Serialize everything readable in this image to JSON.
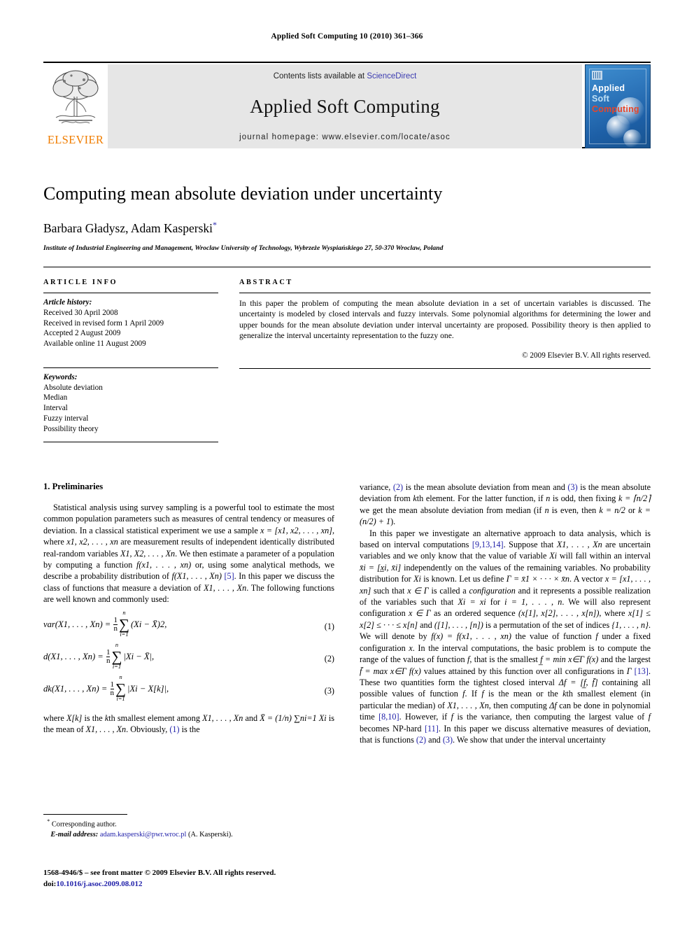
{
  "running_head": "Applied Soft Computing 10 (2010) 361–366",
  "masthead": {
    "contents_prefix": "Contents lists available at ",
    "sciencedirect": "ScienceDirect",
    "journal_title": "Applied Soft Computing",
    "homepage": "journal homepage: www.elsevier.com/locate/asoc",
    "publisher_wordmark": "ELSEVIER",
    "cover": {
      "line1": "Applied",
      "line2": "Soft",
      "line3": "Computing"
    },
    "colors": {
      "link": "#3a3ab0",
      "elsevier_orange": "#F07D00",
      "cover_blue": "#2f78bd",
      "cover_red": "#e8462a"
    }
  },
  "title_block": {
    "title": "Computing mean absolute deviation under uncertainty",
    "authors": "Barbara Gładysz, Adam Kasperski",
    "corresponding_marker": "*",
    "affiliation": "Institute of Industrial Engineering and Management, Wroclaw University of Technology, Wybrzeże Wyspiańskiego 27, 50-370 Wroclaw, Poland"
  },
  "article_info": {
    "heading": "ARTICLE INFO",
    "history_label": "Article history:",
    "history": [
      "Received 30 April 2008",
      "Received in revised form 1 April 2009",
      "Accepted 2 August 2009",
      "Available online 11 August 2009"
    ],
    "keywords_label": "Keywords:",
    "keywords": [
      "Absolute deviation",
      "Median",
      "Interval",
      "Fuzzy interval",
      "Possibility theory"
    ]
  },
  "abstract": {
    "heading": "ABSTRACT",
    "text": "In this paper the problem of computing the mean absolute deviation in a set of uncertain variables is discussed. The uncertainty is modeled by closed intervals and fuzzy intervals. Some polynomial algorithms for determining the lower and upper bounds for the mean absolute deviation under interval uncertainty are proposed. Possibility theory is then applied to generalize the interval uncertainty representation to the fuzzy one.",
    "copyright": "© 2009 Elsevier B.V. All rights reserved."
  },
  "section": {
    "number_title": "1. Preliminaries"
  },
  "left_column": {
    "para1_a": "Statistical analysis using survey sampling is a powerful tool to estimate the most common population parameters such as measures of central tendency or measures of deviation. In a classical statistical experiment we use a sample ",
    "para1_sample": "x = [x1, x2, . . . , xn]",
    "para1_b": ", where ",
    "para1_vars": "x1, x2, . . . , xn",
    "para1_c": " are measurement results of independent identically distributed real-random variables ",
    "para1_Xvars": "X1, X2, . . . , Xn",
    "para1_d": ". We then estimate a parameter of a population by computing a function ",
    "para1_fx": "f(x1, . . . , xn)",
    "para1_e": " or, using some analytical methods, we describe a probability distribution of ",
    "para1_fX": "f(X1, . . . , Xn)",
    "para1_ref": "[5]",
    "para1_f": ". In this paper we discuss the class of functions that measure a deviation of ",
    "para1_Xvars2": "X1, . . . , Xn",
    "para1_g": ". The following functions are well known and commonly used:",
    "eq1": {
      "lhs": "var(X1, . . . , Xn) =",
      "frac_num": "1",
      "frac_den": "n",
      "sum_top": "n",
      "sum_bot": "i=1",
      "rhs": "(Xi − X̄)2,",
      "number": "(1)"
    },
    "eq2": {
      "lhs": "d(X1, . . . , Xn) =",
      "frac_num": "1",
      "frac_den": "n",
      "sum_top": "n",
      "sum_bot": "i=1",
      "rhs": "|Xi − X̄|,",
      "number": "(2)"
    },
    "eq3": {
      "lhs": "dk(X1, . . . , Xn) =",
      "frac_num": "1",
      "frac_den": "n",
      "sum_top": "n",
      "sum_bot": "i=1",
      "rhs": "|Xi − X[k]|,",
      "number": "(3)"
    },
    "para2_a": "where ",
    "para2_Xk": "X[k]",
    "para2_b": " is the ",
    "para2_kth": "k",
    "para2_c": "th smallest element among ",
    "para2_vars": "X1, . . . , Xn",
    "para2_d": " and ",
    "para2_mean": "X̄ = (1/n) ∑ni=1 Xi",
    "para2_e": " is the mean of ",
    "para2_vars2": "X1, . . . , Xn",
    "para2_f": ". Obviously, ",
    "para2_ref1": "(1)",
    "para2_g": " is the"
  },
  "right_column": {
    "para_cont_a": "variance, ",
    "ref2": "(2)",
    "para_cont_b": " is the mean absolute deviation from mean and ",
    "ref3": "(3)",
    "para_cont_c": " is the mean absolute deviation from ",
    "kth": "k",
    "para_cont_d": "th element. For the latter function, if ",
    "n1": "n",
    "para_cont_e": " is odd, then fixing ",
    "kceil": "k = ⌈n/2⌉",
    "para_cont_f": " we get the mean absolute deviation from median (if ",
    "n2": "n",
    "para_cont_g": " is even, then ",
    "kn2": "k = n/2",
    "para_cont_h": " or ",
    "kn21": "k = (n/2) + 1",
    "para_cont_i": ").",
    "para2_a": "In this paper we investigate an alternative approach to data analysis, which is based on interval computations ",
    "refs_a": "[9,13,14]",
    "para2_b": ". Suppose that ",
    "Xvars": "X1, . . . , Xn",
    "para2_c": " are uncertain variables and we only know that the value of variable ",
    "Xi": "Xi",
    "para2_d": " will fall within an interval ",
    "interval": "x̄i = [x̲i, x̄i]",
    "para2_e": " independently on the values of the remaining variables. No probability distribution for ",
    "Xi2": "Xi",
    "para2_f": " is known. Let us define ",
    "gamma": "Γ = x̄1 × · · · × x̄n",
    "para2_g": ". A vector ",
    "vecx": "x = [x1, . . . , xn]",
    "para2_h": " such that ",
    "xingamma": "x ∈ Γ",
    "para2_i": " is called a ",
    "config_it": "configuration",
    "para2_j": " and it represents a possible realization of the variables such that ",
    "Xixi": "Xi = xi",
    "para2_k": " for ",
    "i1n": "i = 1, . . . , n",
    "para2_l": ". We will also represent configuration ",
    "xingamma2": "x ∈ Γ",
    "para2_m": " as an ordered sequence ",
    "ordseq": "(x[1], x[2], . . . , x[n])",
    "para2_n": ", where ",
    "ordineq": "x[1] ≤ x[2] ≤ · · · ≤ x[n]",
    "para2_o": " and ",
    "perm": "([1], . . . , [n])",
    "para2_p": " is a permutation of the set of indices ",
    "indices": "{1, . . . , n}",
    "para2_q": ". We will denote by ",
    "fx_def": "f(x) = f(x1, . . . , xn)",
    "para2_r": " the value of function ",
    "f1": "f",
    "para2_s": " under a fixed configuration ",
    "x_it": "x",
    "para2_t": ". In the interval computations, the basic problem is to compute the range of the values of function ",
    "f2": "f",
    "para2_u": ", that is the smallest ",
    "fmin": "f̲ = min x∈Γ f(x)",
    "para2_v": " and the largest ",
    "fmax": "f̄ = max x∈Γ f(x)",
    "para2_w": " values attained by this function over all configurations in ",
    "gammaT": "Γ",
    "ref13": "[13]",
    "para2_x": ". These two quantities form the tightest closed interval ",
    "delta_f": "Δf = [f̲, f̄]",
    "para2_y": " containing all possible values of function ",
    "f3": "f",
    "para2_z": ". If ",
    "f4": "f",
    "para2_aa": " is the mean or the ",
    "kth2": "k",
    "para2_ab": "th smallest element (in particular the median) of ",
    "Xvars2": "X1, . . . , Xn",
    "para2_ac": ", then computing ",
    "delta_f2": "Δf",
    "para2_ad": " can be done in polynomial time ",
    "refs_b": "[8,10]",
    "para2_ae": ". However, if ",
    "f5": "f",
    "para2_af": " is the variance, then computing the largest value of ",
    "f6": "f",
    "para2_ag": " becomes NP-hard ",
    "ref11": "[11]",
    "para2_ah": ". In this paper we discuss alternative measures of deviation, that is functions ",
    "ref2b": "(2)",
    "para2_ai": " and ",
    "ref3b": "(3)",
    "para2_aj": ". We show that under the interval uncertainty"
  },
  "footnote": {
    "star": "*",
    "corresponding": "Corresponding author.",
    "email_label": "E-mail address:",
    "email": "adam.kasperski@pwr.wroc.pl",
    "email_attribution": "(A. Kasperski)."
  },
  "front_matter": {
    "issn_line": "1568-4946/$ – see front matter © 2009 Elsevier B.V. All rights reserved.",
    "doi_label": "doi:",
    "doi": "10.1016/j.asoc.2009.08.012"
  }
}
